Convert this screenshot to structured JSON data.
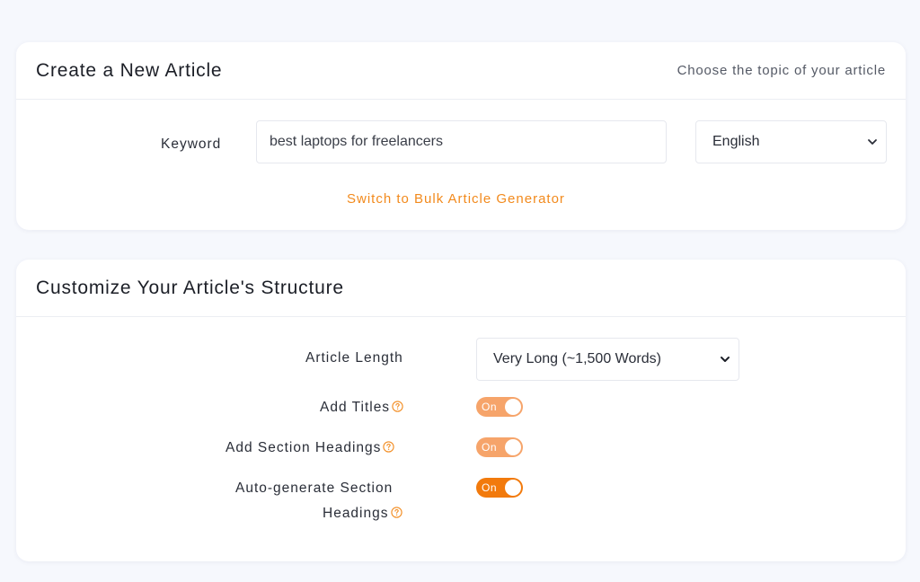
{
  "create_card": {
    "title": "Create a New Article",
    "hint": "Choose the topic of your article",
    "keyword_label": "Keyword",
    "keyword_value": "best laptops for freelancers",
    "language_value": "English",
    "bulk_link": "Switch to Bulk Article Generator"
  },
  "structure_card": {
    "title": "Customize Your Article's Structure",
    "length_label": "Article Length",
    "length_value": "Very Long (~1,500 Words)",
    "toggles": [
      {
        "label": "Add Titles",
        "state": "On",
        "color": "#f6a46a"
      },
      {
        "label": "Add Section Headings",
        "state": "On",
        "color": "#f6a46a"
      },
      {
        "label_line1": "Auto-generate Section",
        "label_line2": "Headings",
        "state": "On",
        "color": "#f27a0c"
      }
    ]
  },
  "colors": {
    "accent": "#f28a1d",
    "toggle_light": "#f6a46a",
    "toggle_strong": "#f27a0c"
  },
  "icons": {
    "help": "help-circle-icon",
    "chevron": "chevron-down-icon"
  }
}
